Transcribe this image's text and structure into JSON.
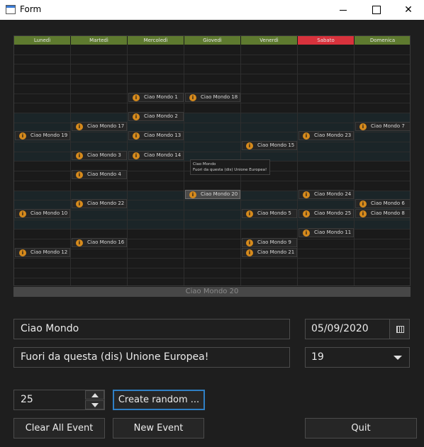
{
  "window": {
    "title": "Form"
  },
  "calendar": {
    "days": [
      "Lunedì",
      "Martedì",
      "Mercoledì",
      "Giovedì",
      "Venerdì",
      "Sabato",
      "Domenica"
    ],
    "highlight_day": "Sabato",
    "events": [
      {
        "label": "Ciao Mondo 1",
        "day": 2,
        "row": 5
      },
      {
        "label": "Ciao Mondo 18",
        "day": 3,
        "row": 5
      },
      {
        "label": "Ciao Mondo 2",
        "day": 2,
        "row": 7
      },
      {
        "label": "Ciao Mondo 17",
        "day": 1,
        "row": 8
      },
      {
        "label": "Ciao Mondo 7",
        "day": 6,
        "row": 8
      },
      {
        "label": "Ciao Mondo 19",
        "day": 0,
        "row": 9
      },
      {
        "label": "Ciao Mondo 13",
        "day": 2,
        "row": 9
      },
      {
        "label": "Ciao Mondo 23",
        "day": 5,
        "row": 9
      },
      {
        "label": "Ciao Mondo 15",
        "day": 4,
        "row": 10
      },
      {
        "label": "Ciao Mondo 3",
        "day": 1,
        "row": 11
      },
      {
        "label": "Ciao Mondo 14",
        "day": 2,
        "row": 11
      },
      {
        "label": "Ciao Mondo 4",
        "day": 1,
        "row": 13
      },
      {
        "label": "Ciao Mondo 20",
        "day": 3,
        "row": 15,
        "selected": true
      },
      {
        "label": "Ciao Mondo 24",
        "day": 5,
        "row": 15
      },
      {
        "label": "Ciao Mondo 22",
        "day": 1,
        "row": 16
      },
      {
        "label": "Ciao Mondo 6",
        "day": 6,
        "row": 16
      },
      {
        "label": "Ciao Mondo 10",
        "day": 0,
        "row": 17
      },
      {
        "label": "Ciao Mondo 5",
        "day": 4,
        "row": 17
      },
      {
        "label": "Ciao Mondo 25",
        "day": 5,
        "row": 17
      },
      {
        "label": "Ciao Mondo 8",
        "day": 6,
        "row": 17
      },
      {
        "label": "Ciao Mondo 11",
        "day": 5,
        "row": 19
      },
      {
        "label": "Ciao Mondo 16",
        "day": 1,
        "row": 20
      },
      {
        "label": "Ciao Mondo 9",
        "day": 4,
        "row": 20
      },
      {
        "label": "Ciao Mondo 12",
        "day": 0,
        "row": 21
      },
      {
        "label": "Ciao Mondo 21",
        "day": 4,
        "row": 21
      }
    ],
    "tooltip": {
      "title": "Ciao Mondo",
      "text": "Fuori da questa (dis) Unione Europea!"
    },
    "status": "Ciao Mondo 20"
  },
  "form": {
    "title_value": "Ciao Mondo",
    "description_value": "Fuori da questa (dis) Unione Europea!",
    "date_value": "05/09/2020",
    "hour_value": "19",
    "count_value": "25"
  },
  "buttons": {
    "random": "Create random ...",
    "clear": "Clear All Event",
    "new": "New Event",
    "quit": "Quit"
  },
  "colors": {
    "header": "#5e7a2f",
    "highlight": "#d8323c",
    "event_icon": "#d68a1c",
    "focus": "#2f7fc4"
  }
}
